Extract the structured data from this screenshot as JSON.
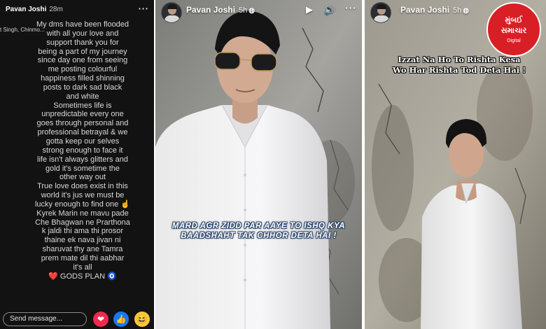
{
  "story_text": {
    "user": "Pavan Joshi",
    "time": "28m",
    "tagged_names": "t Singh, Chinmo...",
    "lines": [
      "My dms have been flooded",
      "with all your love and",
      "support thank you for",
      "being a part of my journey",
      "since day one from seeing",
      "me posting colourful",
      "happiness filled shinning",
      "posts to dark sad black",
      "and white",
      "Sometimes life is",
      "unpredictable every one",
      "goes through personal and",
      "professional betrayal & we",
      "gotta keep our selves",
      "strong enough to face it",
      "life isn't always glitters and",
      "gold it's sometime the",
      "other way out",
      "True love does exist in this",
      "world it's jus we must be",
      "lucky enough to find one ☝️",
      "Kyrek Marin ne mavu pade",
      "Che Bhagwan ne Prarthona",
      "k jaldi thi ama thi prosor",
      "thaine ek nava jivan ni",
      "sharuvat thy ane  Tamra",
      "prem mate dil thi aabhar",
      "it's all",
      "❤️ GODS PLAN 🧿"
    ],
    "send_placeholder": "Send message...",
    "more_icon": "more-dots-icon",
    "reactions": [
      "love-reaction-icon",
      "like-reaction-icon",
      "haha-reaction-icon"
    ]
  },
  "story_photo_1": {
    "user": "Pavan Joshi",
    "time": "5h",
    "caption": "MARD AGR ZIDD PAR AAYE TO ISHQ KYA BAADSHAHT TAK CHHOR DETA HAI !",
    "icons": [
      "play-icon",
      "volume-icon",
      "more-dots-icon"
    ]
  },
  "story_photo_2": {
    "user": "Pavan Joshi",
    "time": "5h",
    "caption_line1": "Izzat Na Ho To Rishta Kesa",
    "caption_line2": "Wo Har Rishta Tod Deta Hai !",
    "logo": {
      "line1": "મુંબઈ",
      "line2": "સમાચાર",
      "line3": "Digital"
    }
  },
  "colors": {
    "text_story_bg": "#121212",
    "love": "#f0294f",
    "like": "#1877f2",
    "haha": "#f7c73f",
    "logo_red": "#d81f26"
  }
}
